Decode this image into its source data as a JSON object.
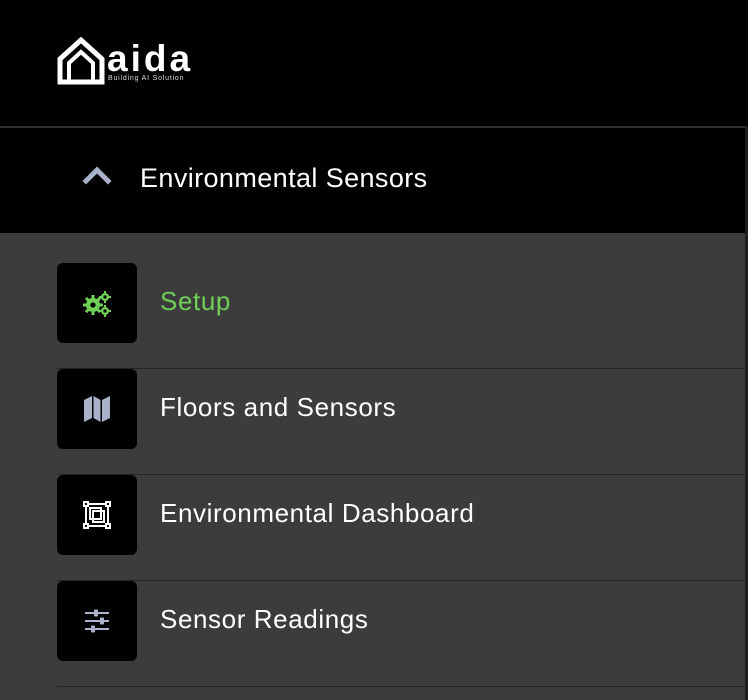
{
  "brand": {
    "name": "aida",
    "tagline": "Building AI Solution"
  },
  "section": {
    "title": "Environmental Sensors",
    "expanded": true,
    "chevron_icon": "chevron-up-icon"
  },
  "menu": {
    "items": [
      {
        "label": "Setup",
        "icon": "gears-icon",
        "active": true
      },
      {
        "label": "Floors and Sensors",
        "icon": "map-icon",
        "active": false
      },
      {
        "label": "Environmental Dashboard",
        "icon": "dashboard-icon",
        "active": false
      },
      {
        "label": "Sensor Readings",
        "icon": "sliders-icon",
        "active": false
      }
    ]
  },
  "colors": {
    "accent": "#6fcf57",
    "background": "#3c3c3c",
    "header": "#000000",
    "icon_muted": "#a9b2c8"
  }
}
